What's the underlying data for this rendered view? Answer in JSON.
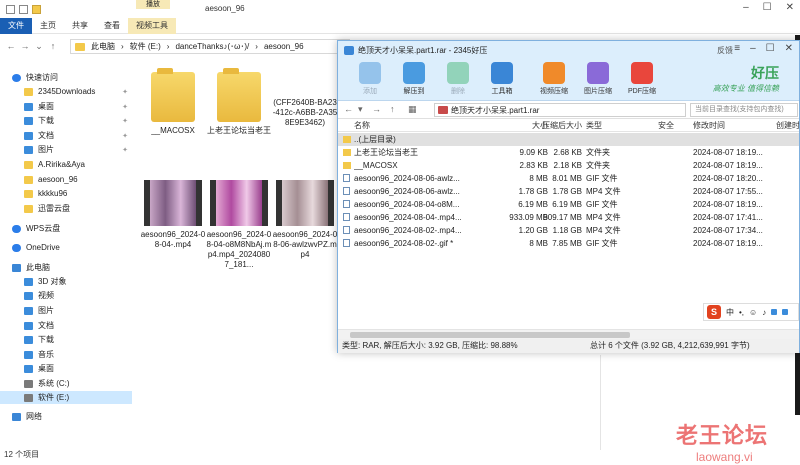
{
  "explorer": {
    "window_title": "aesoon_96",
    "context_tab": "播放",
    "ribbon_tabs": [
      "文件",
      "主页",
      "共享",
      "查看",
      "视频工具"
    ],
    "breadcrumb": [
      "此电脑",
      "软件 (E:)",
      "danceThanks♪(･ω･)/",
      "aesoon_96"
    ],
    "sidebar": {
      "quick_access": "快速访问",
      "items": [
        {
          "label": "2345Downloads",
          "icon": "folder-icon",
          "pinned": true
        },
        {
          "label": "桌面",
          "icon": "desktop-folder-icon",
          "pinned": true
        },
        {
          "label": "下载",
          "icon": "download-icon",
          "pinned": true
        },
        {
          "label": "文档",
          "icon": "document-icon",
          "pinned": true
        },
        {
          "label": "图片",
          "icon": "picture-icon",
          "pinned": true
        },
        {
          "label": "A.Ririka&Aya",
          "icon": "folder-icon",
          "pinned": false
        },
        {
          "label": "aesoon_96",
          "icon": "folder-icon",
          "pinned": false
        },
        {
          "label": "kkkku96",
          "icon": "folder-icon",
          "pinned": false
        },
        {
          "label": "迅雷云盘",
          "icon": "folder-icon",
          "pinned": false
        }
      ],
      "wps": "WPS云盘",
      "onedrive": "OneDrive",
      "this_pc": "此电脑",
      "pc_items": [
        {
          "label": "3D 对象",
          "icon": "3d-objects-icon"
        },
        {
          "label": "视频",
          "icon": "video-icon"
        },
        {
          "label": "图片",
          "icon": "picture-icon"
        },
        {
          "label": "文档",
          "icon": "document-icon"
        },
        {
          "label": "下载",
          "icon": "download-icon"
        },
        {
          "label": "音乐",
          "icon": "music-icon"
        },
        {
          "label": "桌面",
          "icon": "desktop-icon"
        },
        {
          "label": "系统 (C:)",
          "icon": "drive-icon"
        },
        {
          "label": "软件 (E:)",
          "icon": "drive-icon",
          "selected": true
        }
      ],
      "network": "网络"
    },
    "files": [
      {
        "name": "__MACOSX",
        "kind": "folder"
      },
      {
        "name": "上老王论坛当老王",
        "kind": "folder"
      },
      {
        "name": "(CFF2640B-BA23-412c-A6BB-2A358E9E3462)",
        "kind": "file"
      },
      {
        "name": "aesoon96_2024-08-04-.mp4",
        "kind": "video"
      },
      {
        "name": "aesoon96_2024-08-04-o8M8NbAj.mp4.mp4_20240807_181...",
        "kind": "video"
      },
      {
        "name": "aesoon96_2024-08-06-awlzwvPZ.mp4",
        "kind": "video"
      }
    ],
    "status": "12 个项目"
  },
  "archiver": {
    "title": "绝顶天才小呆呆.part1.rar - 2345好压",
    "feedback": "反馈",
    "brand_name": "好压",
    "brand_slogan": "高效专业 值得信赖",
    "tools": [
      {
        "label": "添加",
        "enabled": false,
        "color": "#3f8fd8"
      },
      {
        "label": "解压到",
        "enabled": true,
        "color": "#4a9be0"
      },
      {
        "label": "删除",
        "enabled": false,
        "color": "#38b26a"
      },
      {
        "label": "工具箱",
        "enabled": true,
        "color": "#3a86d6"
      },
      {
        "label": "视频压缩",
        "enabled": true,
        "color": "#f08a2a"
      },
      {
        "label": "图片压缩",
        "enabled": true,
        "color": "#8a6ad8"
      },
      {
        "label": "PDF压缩",
        "enabled": true,
        "color": "#e9463c"
      }
    ],
    "path": "绝顶天才小呆呆.part1.rar",
    "search_placeholder": "当前目录查找(支持包内查找)",
    "columns": [
      "名称",
      "大小",
      "压缩后大小",
      "类型",
      "安全",
      "修改时间",
      "创建时间"
    ],
    "rows": [
      {
        "name": "..(上层目录)",
        "size": "",
        "packed": "",
        "type": "",
        "modified": "",
        "kind": "up"
      },
      {
        "name": "上老王论坛当老王",
        "size": "9.09 KB",
        "packed": "2.68 KB",
        "type": "文件夹",
        "modified": "2024-08-07 18:19...",
        "kind": "folder"
      },
      {
        "name": "__MACOSX",
        "size": "2.83 KB",
        "packed": "2.18 KB",
        "type": "文件夹",
        "modified": "2024-08-07 18:19...",
        "kind": "folder"
      },
      {
        "name": "aesoon96_2024-08-06-awlz...",
        "size": "8 MB",
        "packed": "8.01 MB",
        "type": "GIF 文件",
        "modified": "2024-08-07 18:20...",
        "kind": "file"
      },
      {
        "name": "aesoon96_2024-08-06-awlz...",
        "size": "1.78 GB",
        "packed": "1.78 GB",
        "type": "MP4 文件",
        "modified": "2024-08-07 17:55...",
        "kind": "file"
      },
      {
        "name": "aesoon96_2024-08-04-o8M...",
        "size": "6.19 MB",
        "packed": "6.19 MB",
        "type": "GIF 文件",
        "modified": "2024-08-07 18:19...",
        "kind": "file"
      },
      {
        "name": "aesoon96_2024-08-04-.mp4...",
        "size": "933.09 MB",
        "packed": "909.17 MB",
        "type": "MP4 文件",
        "modified": "2024-08-07 17:41...",
        "kind": "file"
      },
      {
        "name": "aesoon96_2024-08-02-.mp4...",
        "size": "1.20 GB",
        "packed": "1.18 GB",
        "type": "MP4 文件",
        "modified": "2024-08-07 17:34...",
        "kind": "file"
      },
      {
        "name": "aesoon96_2024-08-02-.gif *",
        "size": "8 MB",
        "packed": "7.85 MB",
        "type": "GIF 文件",
        "modified": "2024-08-07 18:19...",
        "kind": "file"
      }
    ],
    "status_left": "类型: RAR, 解压后大小: 3.92 GB, 压缩比: 98.88%",
    "status_right": "总计 6 个文件 (3.92 GB, 4,212,639,991 字节)"
  },
  "ime": {
    "lang": "中"
  },
  "watermark": {
    "line1": "老王论坛",
    "line2": "laowang.vi"
  }
}
